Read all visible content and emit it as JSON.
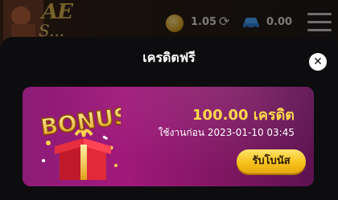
{
  "header": {
    "logo_text": "AE",
    "logo_sub": "S...",
    "balance": "1.05",
    "credit": "0.00",
    "coin_icon": "coin-icon",
    "refresh_icon": "refresh-icon",
    "car_icon": "car-icon",
    "menu_icon": "hamburger-menu-icon"
  },
  "modal": {
    "title": "เครดิตฟรี",
    "close_label": "✕"
  },
  "bonus_card": {
    "art_text": "BONUS",
    "amount": "100.00 เครดิต",
    "expiry": "ใช้งานก่อน 2023-01-10 03:45",
    "claim_label": "รับโบนัส",
    "colors": {
      "card": "#a0197a",
      "amount": "#ffd84a",
      "button": "#f7c21c"
    }
  }
}
